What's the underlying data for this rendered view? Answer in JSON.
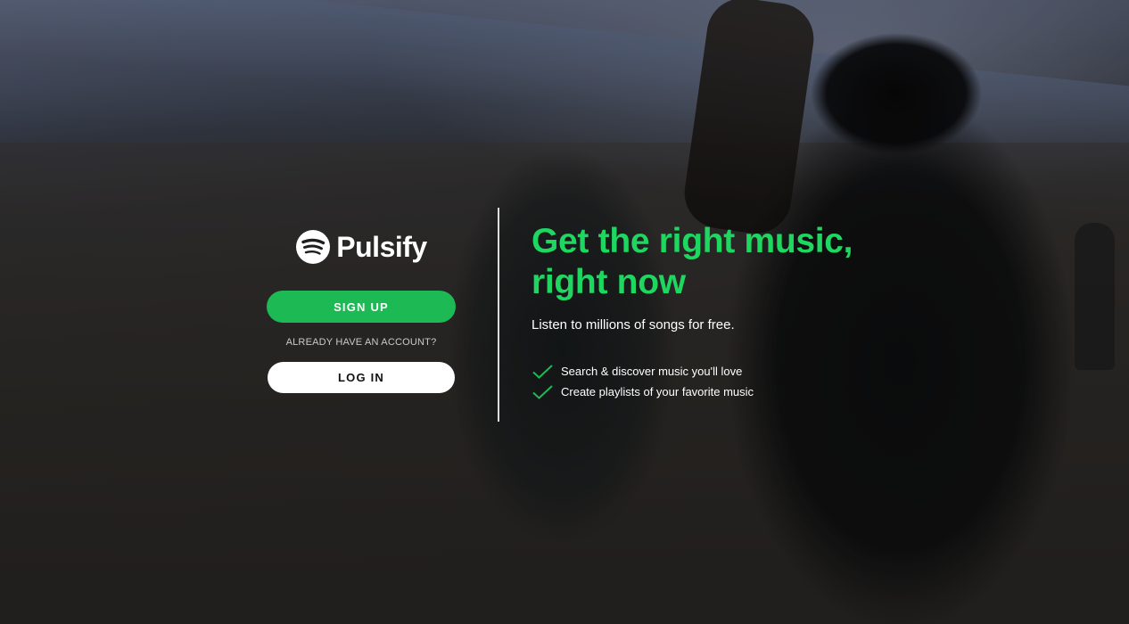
{
  "brand": {
    "name": "Pulsify",
    "logo_icon": "pulsify-logo-icon",
    "accent_color": "#1db954"
  },
  "auth": {
    "signup_label": "SIGN UP",
    "account_prompt": "ALREADY HAVE AN ACCOUNT?",
    "login_label": "LOG IN"
  },
  "hero": {
    "headline_line1": "Get the right music,",
    "headline_line2": "right now",
    "subtitle": "Listen to millions of songs for free.",
    "features": [
      {
        "icon": "check-icon",
        "text": "Search & discover music you'll love"
      },
      {
        "icon": "check-icon",
        "text": "Create playlists of your favorite music"
      }
    ]
  }
}
